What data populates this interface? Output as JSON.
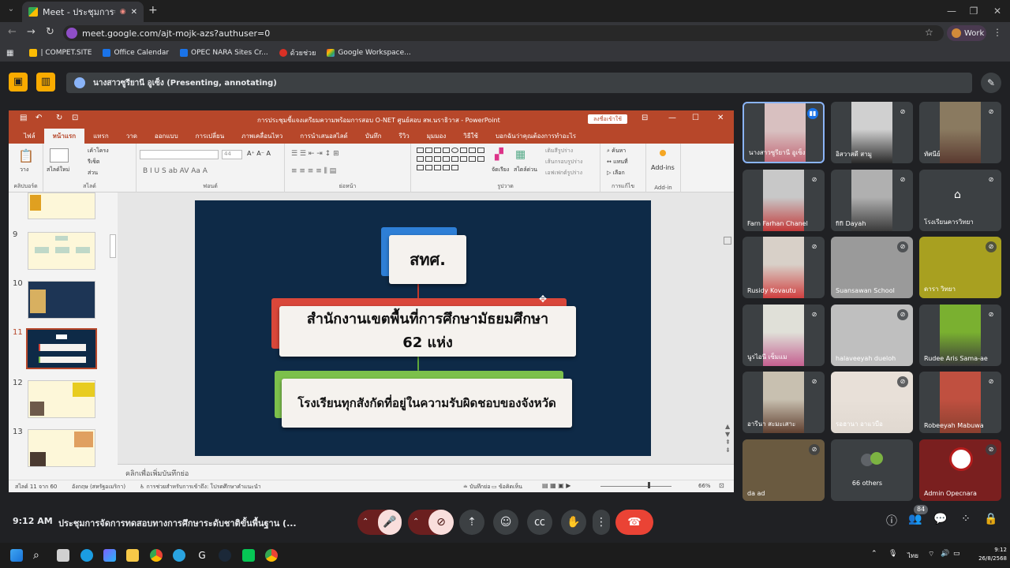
{
  "browser": {
    "tab_title": "Meet - ประชุมการจัดการทดสอ…",
    "url": "meet.google.com/ajt-mojk-azs?authuser=0",
    "profile_label": "Work",
    "bookmarks": [
      "| COMPET.SITE",
      "Office Calendar",
      "OPEC NARA Sites Cr...",
      "ด้วยช่วย",
      "Google Workspace..."
    ]
  },
  "meet": {
    "presenter_label": "นางสาวซูรียานี อูเซ็ง (Presenting, annotating)",
    "time": "9:12 AM",
    "meeting_name": "ประชุมการจัดการทดสอบทางการศึกษาระดับชาติขั้นพื้นฐาน (...",
    "people_count": "84",
    "participants": [
      {
        "name": "นางสาวซูรียานี อูเซ็ง",
        "muted": false,
        "active": true
      },
      {
        "name": "อิสวาสดี สามู",
        "muted": true
      },
      {
        "name": "ทัศนีย์",
        "muted": true
      },
      {
        "name": "Farn Farhan Chanel",
        "muted": true
      },
      {
        "name": "fifi Dayah",
        "muted": true
      },
      {
        "name": "โรงเรียนคารวิทยา",
        "muted": true
      },
      {
        "name": "Rusidy Kovautu",
        "muted": true
      },
      {
        "name": "Suansawan School",
        "muted": true
      },
      {
        "name": "ดารา วิทยา",
        "muted": true
      },
      {
        "name": "นูรไอนี เซ็มแม",
        "muted": true
      },
      {
        "name": "halaveeyah dueloh",
        "muted": true
      },
      {
        "name": "Rudee Aris Sama-ae",
        "muted": true
      },
      {
        "name": "อารีนา สะมะเสาะ",
        "muted": true
      },
      {
        "name": "รอฮานา อาแวบือ",
        "muted": true
      },
      {
        "name": "Robeeyah Mabuwa",
        "muted": true
      },
      {
        "name": "da ad",
        "muted": true
      },
      {
        "name": "66 others",
        "muted": false
      },
      {
        "name": "Admin Opecnara",
        "muted": true
      }
    ]
  },
  "ppt": {
    "title": "การประชุมชี้แจงเตรียมความพร้อมการสอบ O-NET ศูนย์สอบ สพ.นราธิวาส - PowerPoint",
    "signin": "ลงชื่อเข้าใช้",
    "tabs": [
      "ไฟล์",
      "หน้าแรก",
      "แทรก",
      "วาด",
      "ออกแบบ",
      "การเปลี่ยน",
      "ภาพเคลื่อนไหว",
      "การนำเสนอสไลด์",
      "บันทึก",
      "รีวิว",
      "มุมมอง",
      "วิธีใช้",
      "บอกฉันว่าคุณต้องการทำอะไร"
    ],
    "groups": [
      "คลิปบอร์ด",
      "สไลด์",
      "ฟอนต์",
      "ย่อหน้า",
      "รูปวาด",
      "การแก้ไข",
      "Add-in"
    ],
    "ribbon_items": {
      "paste": "วาง",
      "new_slide": "สไลด์ใหม่",
      "layout": "เค้าโครง",
      "reset": "รีเซ็ต",
      "section": "ส่วน",
      "font_size": "44",
      "arrange": "จัดเรียง",
      "quick_styles": "สไตล์ด่วน",
      "find": "ค้นหา",
      "replace": "แทนที่",
      "select": "เลือก",
      "addins": "Add-ins",
      "fill": "เติมสีรูปร่าง",
      "outline": "เส้นกรอบรูปร่าง",
      "effects": "เอฟเฟกต์รูปร่าง"
    },
    "slide_numbers": [
      "9",
      "10",
      "11",
      "12",
      "13"
    ],
    "slide_boxes": {
      "top": "สทศ.",
      "middle_line1": "สำนักงานเขตพื้นที่การศึกษามัธยมศึกษา",
      "middle_line2": "62 แห่ง",
      "bottom": "โรงเรียนทุกสังกัดที่อยู่ในความรับผิดชอบของจังหวัด"
    },
    "notes_placeholder": "คลิกเพื่อเพิ่มบันทึกย่อ",
    "status": {
      "slide_info": "สไลด์ 11 จาก 60",
      "language": "อังกฤษ (สหรัฐอเมริกา)",
      "accessibility": "การช่วยสำหรับการเข้าถึง: โปรดศึกษาคำแนะนำ",
      "notes": "บันทึกย่อ",
      "comments": "ข้อคิดเห็น",
      "zoom": "66%"
    }
  },
  "taskbar": {
    "time": "9:12",
    "date": "26/8/2568",
    "lang": "ไทย"
  },
  "colors": {
    "ppt_accent": "#b7472a",
    "slide_bg": "#0e2a47",
    "end_call": "#ea4335",
    "presenting_yellow": "#f9ab00"
  }
}
